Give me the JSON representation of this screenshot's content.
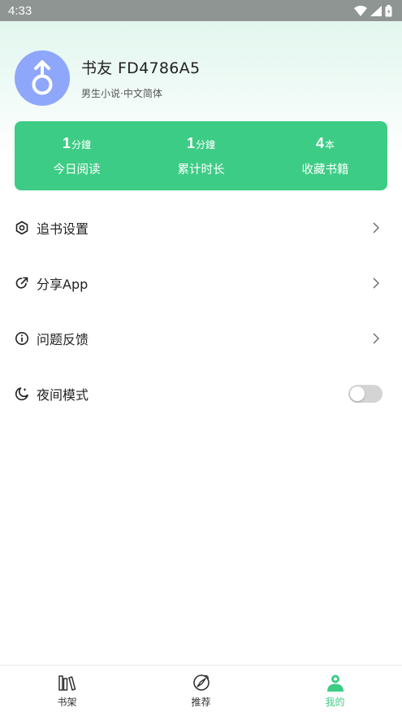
{
  "status_bar": {
    "time": "4:33"
  },
  "profile": {
    "username": "书友 FD4786A5",
    "subtitle": "男生小说·中文简体",
    "avatar_icon": "male-symbol-icon"
  },
  "stats": [
    {
      "value": "1",
      "unit": "分鐘",
      "label": "今日阅读"
    },
    {
      "value": "1",
      "unit": "分鐘",
      "label": "累计时长"
    },
    {
      "value": "4",
      "unit": "本",
      "label": "收藏书籍"
    }
  ],
  "menu": {
    "follow_settings": "追书设置",
    "share_app": "分享App",
    "feedback": "问题反馈",
    "night_mode": "夜间模式",
    "night_mode_on": false
  },
  "bottom_nav": {
    "bookshelf": "书架",
    "recommend": "推荐",
    "mine": "我的",
    "active": "mine"
  },
  "colors": {
    "accent": "#3dcc85",
    "avatar": "#8ea7fa",
    "status_bar": "#8e9592"
  }
}
